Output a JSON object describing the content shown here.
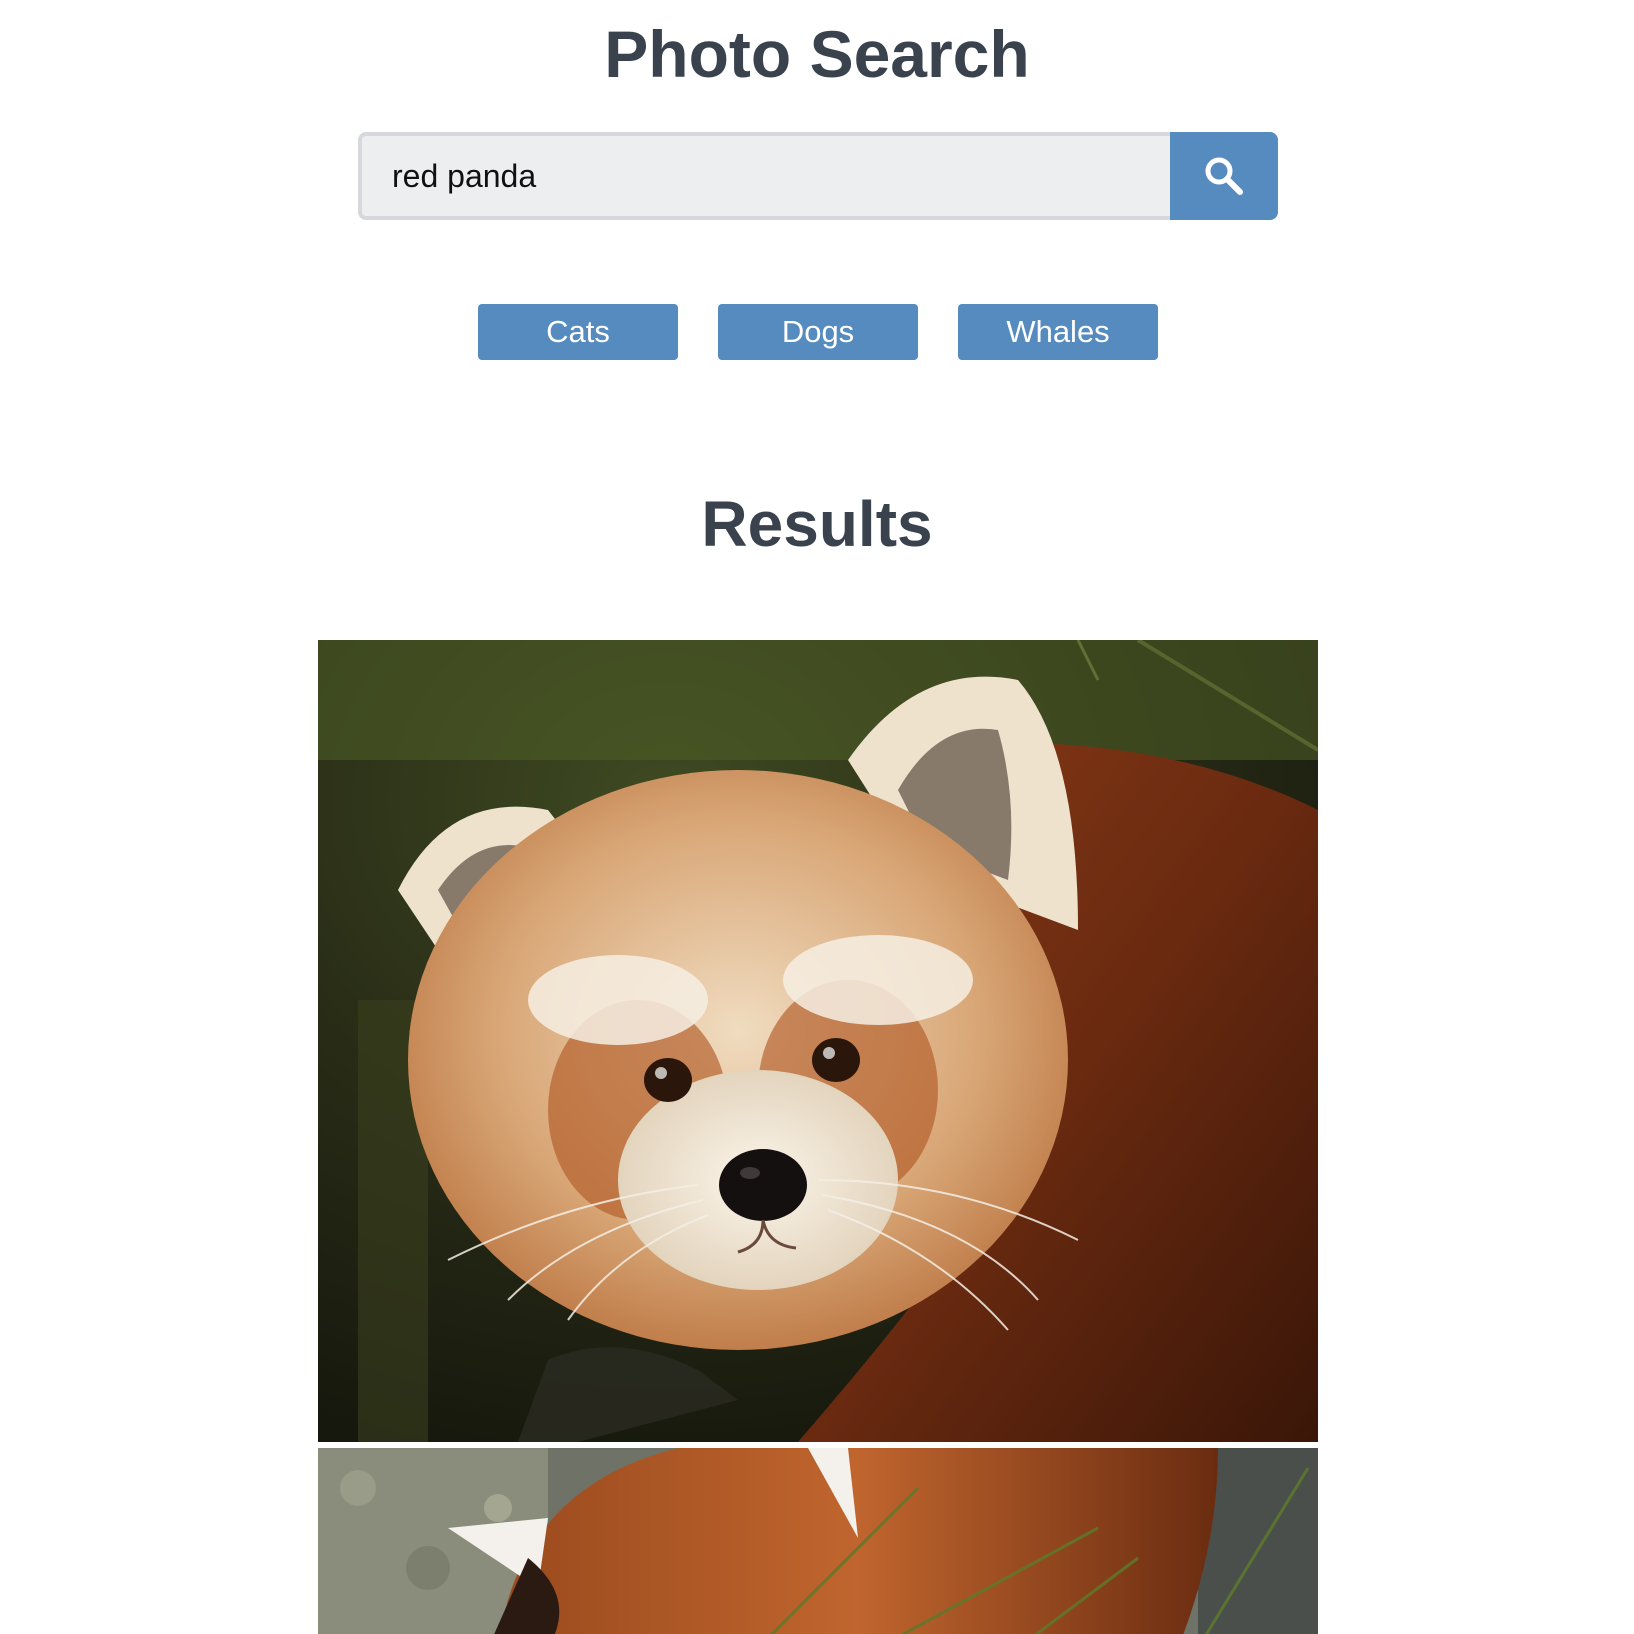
{
  "header": {
    "title": "Photo Search"
  },
  "search": {
    "value": "red panda",
    "button_icon": "search-icon"
  },
  "quick_searches": [
    {
      "label": "Cats"
    },
    {
      "label": "Dogs"
    },
    {
      "label": "Whales"
    }
  ],
  "results": {
    "heading": "Results",
    "photos": [
      {
        "subject": "red panda"
      },
      {
        "subject": "red panda"
      }
    ]
  },
  "colors": {
    "accent": "#558bbf",
    "heading": "#3a434d",
    "input_background": "#eceef0"
  }
}
